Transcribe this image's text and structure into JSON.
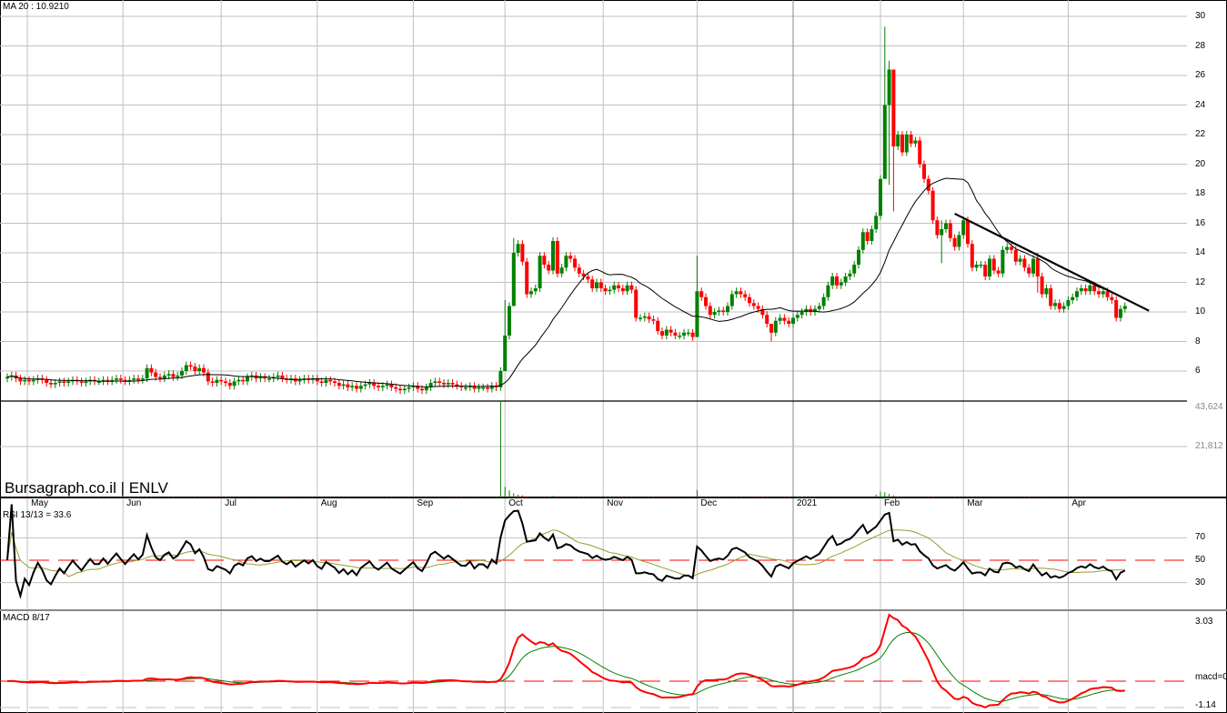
{
  "chart_data": {
    "type": "candlestick",
    "symbol_label": "Bursagraph.co.il | ENLV",
    "ma_label": "MA 20 : 10.9210",
    "rsi_label": "RSI 13/13 = 33.6",
    "macd_label": "MACD 8/17",
    "colors": {
      "up": "#008000",
      "down": "#ff0000",
      "grid": "#c0c0c0",
      "ma": "#000000",
      "rsi": "#000000",
      "rsi_signal": "#9a9a30",
      "macd": "#ff0000",
      "macd_signal": "#008000"
    },
    "price_axis": {
      "min": 4,
      "max": 30,
      "ticks": [
        "6",
        "8",
        "10",
        "12",
        "14",
        "16",
        "18",
        "20",
        "22",
        "24",
        "26",
        "28",
        "30"
      ]
    },
    "volume_axis": {
      "ticks": [
        "21,812",
        "43,624"
      ]
    },
    "rsi_axis": {
      "ticks": [
        "30",
        "50",
        "70"
      ]
    },
    "macd_axis": {
      "ticks": [
        "3.03",
        "macd=0",
        "-1.14"
      ]
    },
    "months": [
      {
        "label": "May",
        "index": 4.6
      },
      {
        "label": "Jun",
        "index": 26.5
      },
      {
        "label": "Jul",
        "index": 49
      },
      {
        "label": "Aug",
        "index": 71
      },
      {
        "label": "Sep",
        "index": 93
      },
      {
        "label": "Oct",
        "index": 114
      },
      {
        "label": "Nov",
        "index": 136.5
      },
      {
        "label": "Dec",
        "index": 158
      },
      {
        "label": "2021",
        "index": 180
      },
      {
        "label": "Feb",
        "index": 200
      },
      {
        "label": "Mar",
        "index": 219
      },
      {
        "label": "Apr",
        "index": 243
      }
    ],
    "first_open": 5.5,
    "closes": [
      5.6,
      5.7,
      5.5,
      5.3,
      5.4,
      5.3,
      5.4,
      5.5,
      5.4,
      5.2,
      5.1,
      5.2,
      5.3,
      5.2,
      5.3,
      5.4,
      5.3,
      5.2,
      5.3,
      5.4,
      5.3,
      5.3,
      5.4,
      5.3,
      5.4,
      5.5,
      5.4,
      5.3,
      5.4,
      5.5,
      5.4,
      5.5,
      6.2,
      5.9,
      5.6,
      5.5,
      5.7,
      5.8,
      5.6,
      5.7,
      6.0,
      6.4,
      6.3,
      6.0,
      6.2,
      5.9,
      5.3,
      5.2,
      5.4,
      5.3,
      5.2,
      5.0,
      5.3,
      5.4,
      5.3,
      5.6,
      5.7,
      5.5,
      5.6,
      5.5,
      5.5,
      5.6,
      5.7,
      5.5,
      5.4,
      5.5,
      5.3,
      5.4,
      5.5,
      5.4,
      5.5,
      5.3,
      5.2,
      5.4,
      5.3,
      5.2,
      5.0,
      5.1,
      4.9,
      5.0,
      4.8,
      5.0,
      5.1,
      5.2,
      5.0,
      4.9,
      5.0,
      5.1,
      4.9,
      4.8,
      4.7,
      4.8,
      4.9,
      5.0,
      4.8,
      4.7,
      4.9,
      5.2,
      5.3,
      5.2,
      5.1,
      5.2,
      5.1,
      5.0,
      4.9,
      4.9,
      5.0,
      4.8,
      4.9,
      4.9,
      4.8,
      5.0,
      4.9,
      6.0,
      8.4,
      10.4,
      14.0,
      14.6,
      13.4,
      11.2,
      11.4,
      11.6,
      13.8,
      13.2,
      12.8,
      14.8,
      12.6,
      13.0,
      13.8,
      13.6,
      13.0,
      12.6,
      12.4,
      12.2,
      11.6,
      12.0,
      11.6,
      11.4,
      11.5,
      11.8,
      11.6,
      11.4,
      11.8,
      11.5,
      9.6,
      9.6,
      9.7,
      9.5,
      9.4,
      8.7,
      8.4,
      8.8,
      8.6,
      8.4,
      8.4,
      8.6,
      8.6,
      8.3,
      11.4,
      11.0,
      10.4,
      9.8,
      10.0,
      10.1,
      10.0,
      10.4,
      11.2,
      11.4,
      11.2,
      11.0,
      10.6,
      10.4,
      10.2,
      9.8,
      9.2,
      8.6,
      9.4,
      9.6,
      9.4,
      9.2,
      9.6,
      9.8,
      10.0,
      10.2,
      10.0,
      10.2,
      10.4,
      11.0,
      11.8,
      12.4,
      11.8,
      12.0,
      12.4,
      12.6,
      13.2,
      14.2,
      15.4,
      14.8,
      15.6,
      16.5,
      19.0,
      24.0,
      26.4,
      21.2,
      22.0,
      20.8,
      22.0,
      21.4,
      21.6,
      20.0,
      19.0,
      18.2,
      16.2,
      15.2,
      15.6,
      16.0,
      15.0,
      14.4,
      15.2,
      16.2,
      14.6,
      13.0,
      13.2,
      13.2,
      12.4,
      13.6,
      12.8,
      12.6,
      14.2,
      14.4,
      14.2,
      13.4,
      13.6,
      13.0,
      12.6,
      13.6,
      12.4,
      11.2,
      11.6,
      10.4,
      10.6,
      10.2,
      10.4,
      10.8,
      11.0,
      11.4,
      11.6,
      11.4,
      11.8,
      11.4,
      11.2,
      11.4,
      11.0,
      10.8,
      9.6,
      10.2,
      10.4
    ],
    "extremes": [
      [
        114,
        10.8,
        7.8
      ],
      [
        116,
        15.0,
        12.4
      ],
      [
        158,
        13.8,
        10.4
      ],
      [
        175,
        9.0,
        8.0
      ],
      [
        201,
        29.3,
        21.0
      ],
      [
        202,
        27.0,
        18.6
      ],
      [
        203,
        22.4,
        16.8
      ],
      [
        214,
        16.2,
        13.3
      ],
      [
        236,
        14.0,
        11.3
      ]
    ],
    "volume": {
      "default": 250,
      "bars": [
        [
          113,
          52000
        ],
        [
          114,
          4500
        ],
        [
          115,
          3000
        ],
        [
          116,
          1800
        ],
        [
          117,
          1200
        ],
        [
          118,
          900
        ],
        [
          125,
          700
        ],
        [
          158,
          3200
        ],
        [
          199,
          1200
        ],
        [
          200,
          2500
        ],
        [
          201,
          2200
        ],
        [
          202,
          1500
        ],
        [
          203,
          900
        ]
      ]
    },
    "trendline": {
      "from": [
        217,
        16.65
      ],
      "to": [
        261.5,
        10.08
      ]
    }
  }
}
